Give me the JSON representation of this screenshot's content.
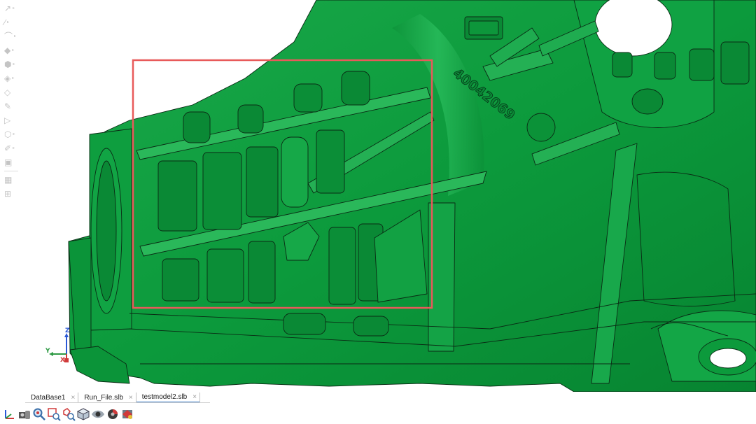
{
  "viewport": {
    "model_label": "40042069",
    "model_color": "#0c9a3c",
    "selection_color": "#e85a5a"
  },
  "left_toolbar": {
    "tools": [
      {
        "icon": "pointer-icon",
        "glyph": "↗",
        "expand": true
      },
      {
        "icon": "line-icon",
        "glyph": "∕",
        "expand": true
      },
      {
        "icon": "curve-icon",
        "glyph": "⌒",
        "expand": true
      },
      {
        "icon": "surface-icon",
        "glyph": "◆",
        "expand": true
      },
      {
        "icon": "solid-icon",
        "glyph": "⬢",
        "expand": true
      },
      {
        "icon": "surface-edit-icon",
        "glyph": "◈",
        "expand": true
      },
      {
        "icon": "block-icon",
        "glyph": "◇",
        "expand": false
      },
      {
        "icon": "pencil-icon",
        "glyph": "✎",
        "expand": false
      },
      {
        "icon": "node-icon",
        "glyph": "▷",
        "expand": false
      },
      {
        "icon": "element-icon",
        "glyph": "⬡",
        "expand": true
      },
      {
        "icon": "brush-icon",
        "glyph": "✐",
        "expand": true
      },
      {
        "icon": "box-icon",
        "glyph": "▣",
        "expand": false
      },
      {
        "icon": "separator",
        "glyph": "",
        "expand": false
      },
      {
        "icon": "mesh-icon",
        "glyph": "▦",
        "expand": false
      },
      {
        "icon": "measure-icon",
        "glyph": "⊞",
        "expand": false
      }
    ]
  },
  "triad": {
    "z": "Z",
    "y": "Y",
    "x": "X"
  },
  "tabs": [
    {
      "label": "DataBase1",
      "close": "×",
      "active": false
    },
    {
      "label": "Run_File.slb",
      "close": "×",
      "active": false
    },
    {
      "label": "testmodel2.slb",
      "close": "×",
      "active": true
    }
  ],
  "bottom_toolbar": {
    "buttons": [
      {
        "icon": "axis-triad-icon"
      },
      {
        "icon": "camera-icon"
      },
      {
        "icon": "zoom-icon"
      },
      {
        "icon": "zoom-window-icon"
      },
      {
        "icon": "zoom-selection-icon"
      },
      {
        "icon": "cube-view-icon"
      },
      {
        "icon": "visibility-eye-icon"
      },
      {
        "icon": "section-cut-icon"
      },
      {
        "icon": "render-mode-icon"
      }
    ]
  }
}
